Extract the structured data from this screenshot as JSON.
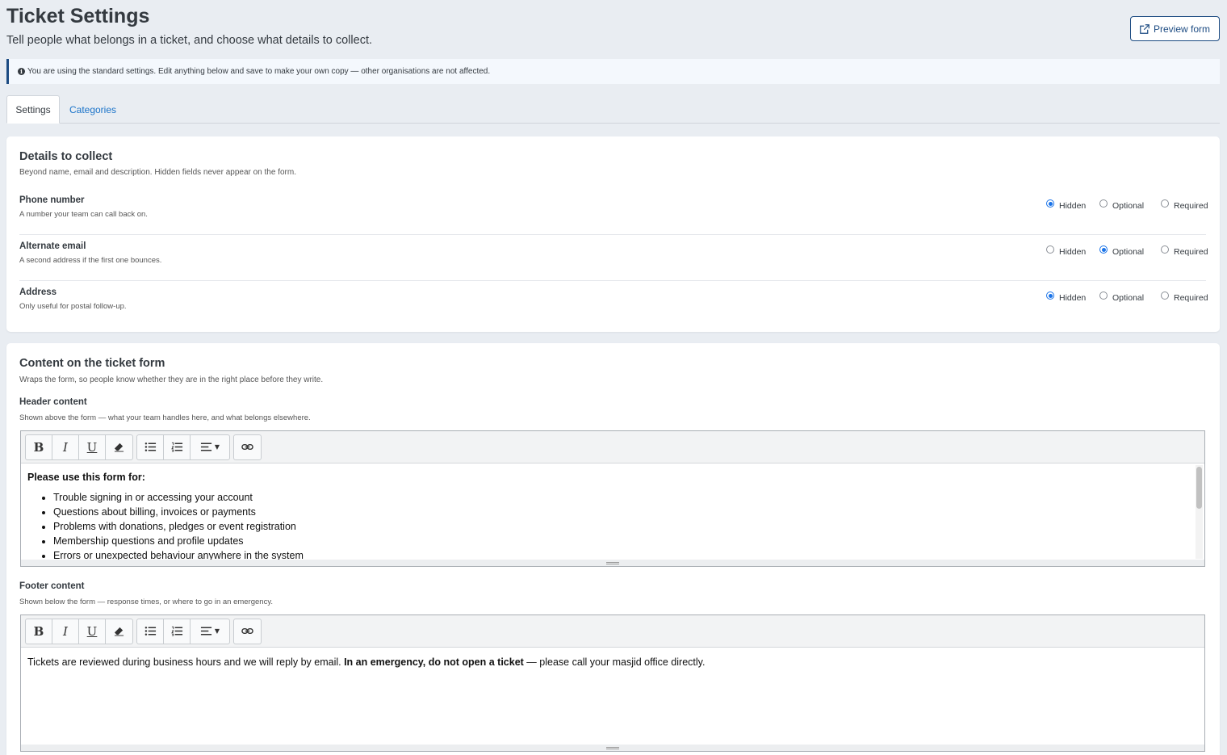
{
  "header": {
    "title": "Ticket Settings",
    "subtitle": "Tell people what belongs in a ticket, and choose what details to collect.",
    "preview_label": "Preview form"
  },
  "notice": {
    "text": "You are using the standard settings. Edit anything below and save to make your own copy — other organisations are not affected."
  },
  "tabs": [
    {
      "label": "Settings",
      "active": true
    },
    {
      "label": "Categories",
      "active": false
    }
  ],
  "details": {
    "title": "Details to collect",
    "subtitle": "Beyond name, email and description. Hidden fields never appear on the form.",
    "option_labels": [
      "Hidden",
      "Optional",
      "Required"
    ],
    "fields": [
      {
        "label": "Phone number",
        "help": "A number your team can call back on.",
        "selected": "Hidden"
      },
      {
        "label": "Alternate email",
        "help": "A second address if the first one bounces.",
        "selected": "Optional"
      },
      {
        "label": "Address",
        "help": "Only useful for postal follow-up.",
        "selected": "Hidden"
      }
    ]
  },
  "content": {
    "title": "Content on the ticket form",
    "subtitle": "Wraps the form, so people know whether they are in the right place before they write.",
    "header_section": {
      "label": "Header content",
      "help": "Shown above the form — what your team handles here, and what belongs elsewhere.",
      "intro": "Please use this form for:",
      "items": [
        "Trouble signing in or accessing your account",
        "Questions about billing, invoices or payments",
        "Problems with donations, pledges or event registration",
        "Membership questions and profile updates",
        "Errors or unexpected behaviour anywhere in the system"
      ]
    },
    "footer_section": {
      "label": "Footer content",
      "help": "Shown below the form — response times, or where to go in an emergency.",
      "text_before": "Tickets are reviewed during business hours and we will reply by email. ",
      "text_bold": "In an emergency, do not open a ticket",
      "text_after": " — please call your masjid office directly."
    },
    "toolbar": {
      "bold": "B",
      "italic": "I",
      "underline": "U"
    }
  },
  "colors": {
    "accent": "#1c4b82",
    "link": "#1a73c9",
    "radio_selected": "#1a73e8"
  }
}
